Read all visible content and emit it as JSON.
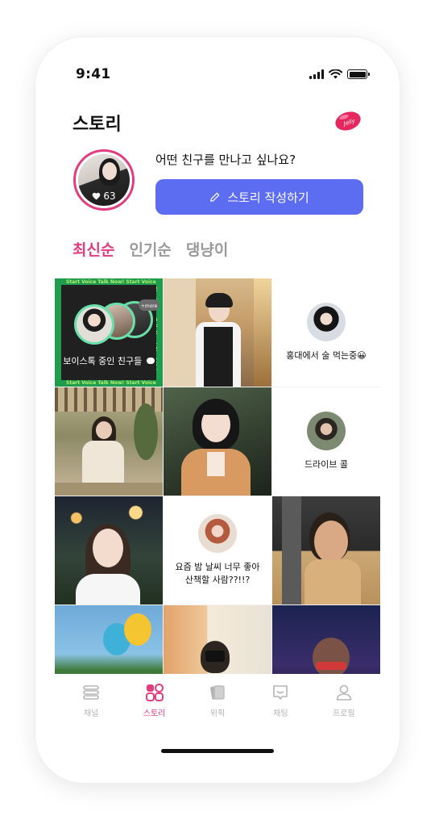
{
  "status_bar": {
    "time": "9:41"
  },
  "header": {
    "title": "스토리",
    "jelly_badge": "Jelly"
  },
  "profile": {
    "like_count": "63",
    "prompt": "어떤 친구를 만나고 싶나요?",
    "write_button_label": "스토리 작성하기"
  },
  "sort_tabs": [
    {
      "label": "최신순",
      "active": true
    },
    {
      "label": "인기순",
      "active": false
    },
    {
      "label": "댕냥이",
      "active": false
    }
  ],
  "voice_card": {
    "marquee": "Start Voice Talk Now! Start Voice",
    "more_badge": "+more",
    "caption": "보이스톡 중인 친구들"
  },
  "text_stories": [
    {
      "caption": "홍대에서 술 먹는중😀"
    },
    {
      "caption": "드라이브 콜"
    },
    {
      "caption": "요즘 밤 날씨 너무 좋아\n산책할 사람??!!?"
    }
  ],
  "tab_bar": [
    {
      "label": "채널",
      "icon": "channel-icon",
      "active": false
    },
    {
      "label": "스토리",
      "icon": "story-grid-icon",
      "active": true
    },
    {
      "label": "위픽",
      "icon": "cards-icon",
      "active": false
    },
    {
      "label": "채팅",
      "icon": "chat-icon",
      "active": false
    },
    {
      "label": "프로필",
      "icon": "person-icon",
      "active": false
    }
  ],
  "colors": {
    "accent_pink": "#e23d80",
    "primary_blue": "#5d6df1",
    "voice_green": "#1f9c4d"
  }
}
